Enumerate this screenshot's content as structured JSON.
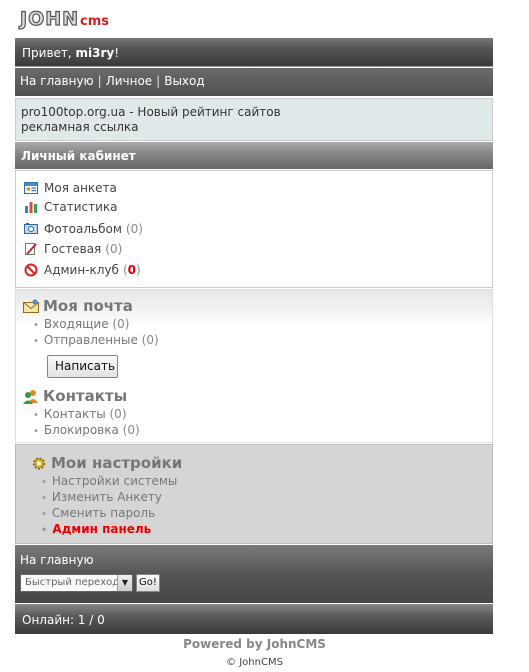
{
  "logo": {
    "john": "JOHN",
    "cms": "cms"
  },
  "greeting": {
    "prefix": "Привет, ",
    "user": "mi3ry",
    "suffix": "!"
  },
  "nav": {
    "home": "На главную",
    "personal": "Личное",
    "logout": "Выход",
    "separator": "|"
  },
  "ad": {
    "line1": "pro100top.org.ua - Новый рейтинг сайтов",
    "line2": "рекламная ссылка"
  },
  "cabinet": {
    "title": "Личный кабинет"
  },
  "menu": {
    "profile": {
      "label": "Моя анкета",
      "icon": "profile-card-icon"
    },
    "stats": {
      "label": "Статистика",
      "icon": "bar-chart-icon"
    },
    "album": {
      "label": "Фотоальбом",
      "count": "(0)",
      "icon": "photo-album-icon"
    },
    "guestbook": {
      "label": "Гостевая",
      "count": "(0)",
      "icon": "guestbook-pen-icon"
    },
    "adminclub": {
      "label": "Админ-клуб",
      "count_open": "(",
      "count_value": "0",
      "count_close": ")",
      "icon": "no-entry-icon"
    }
  },
  "mail": {
    "title": "Моя почта",
    "inbox": {
      "label": "Входящие",
      "count": "(0)"
    },
    "sent": {
      "label": "Отправленные",
      "count": "(0)"
    },
    "write_button": "Написать"
  },
  "contacts": {
    "title": "Контакты",
    "contacts": {
      "label": "Контакты",
      "count": "(0)"
    },
    "blocked": {
      "label": "Блокировка",
      "count": "(0)"
    }
  },
  "settings": {
    "title": "Мои настройки",
    "items": [
      "Настройки системы",
      "Изменить Анкету",
      "Сменить пароль"
    ],
    "admin": "Админ панель"
  },
  "footer": {
    "home": "На главную",
    "quick_jump": "Быстрый переход",
    "go": "Go!",
    "online": "Онлайн: 1 / 0",
    "powered": "Powered by JohnCMS",
    "copyright": "© JohnCMS"
  },
  "colors": {
    "accent_red": "#dd0000",
    "header_dark": "#4a4a4a",
    "ad_bg": "#e1e8ea",
    "settings_bg": "#d5d5d5"
  }
}
